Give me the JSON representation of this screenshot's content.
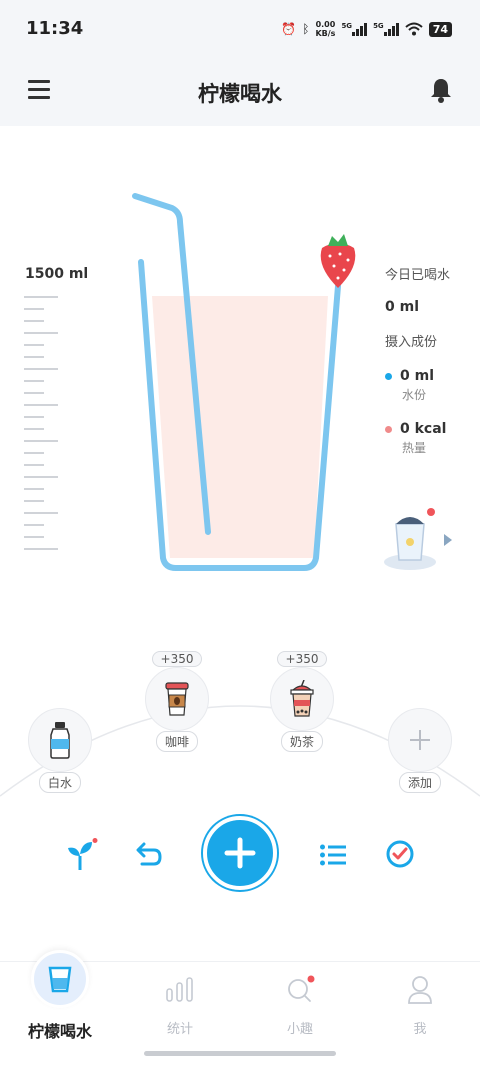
{
  "status_bar": {
    "time": "11:34",
    "net_speed_top": "0.00",
    "net_speed_bottom": "KB/s",
    "sim1": "5G",
    "sim2": "5G",
    "battery": "74"
  },
  "header": {
    "title": "柠檬喝水"
  },
  "cup": {
    "capacity": "1500 ml"
  },
  "stats": {
    "today_label": "今日已喝水",
    "today_value": "0 ml",
    "composition_label": "摄入成份",
    "water_value": "0 ml",
    "water_label": "水份",
    "calorie_value": "0 kcal",
    "calorie_label": "热量"
  },
  "drinks": [
    {
      "label": "白水"
    },
    {
      "label": "咖啡",
      "amount": "+350"
    },
    {
      "label": "奶茶",
      "amount": "+350"
    },
    {
      "label": "添加"
    }
  ],
  "tabs": [
    {
      "label": "柠檬喝水"
    },
    {
      "label": "统计"
    },
    {
      "label": "小趣"
    },
    {
      "label": "我"
    }
  ],
  "colors": {
    "accent": "#1aa7e8",
    "juice": "#fdebe7",
    "badge": "#f0555a"
  }
}
